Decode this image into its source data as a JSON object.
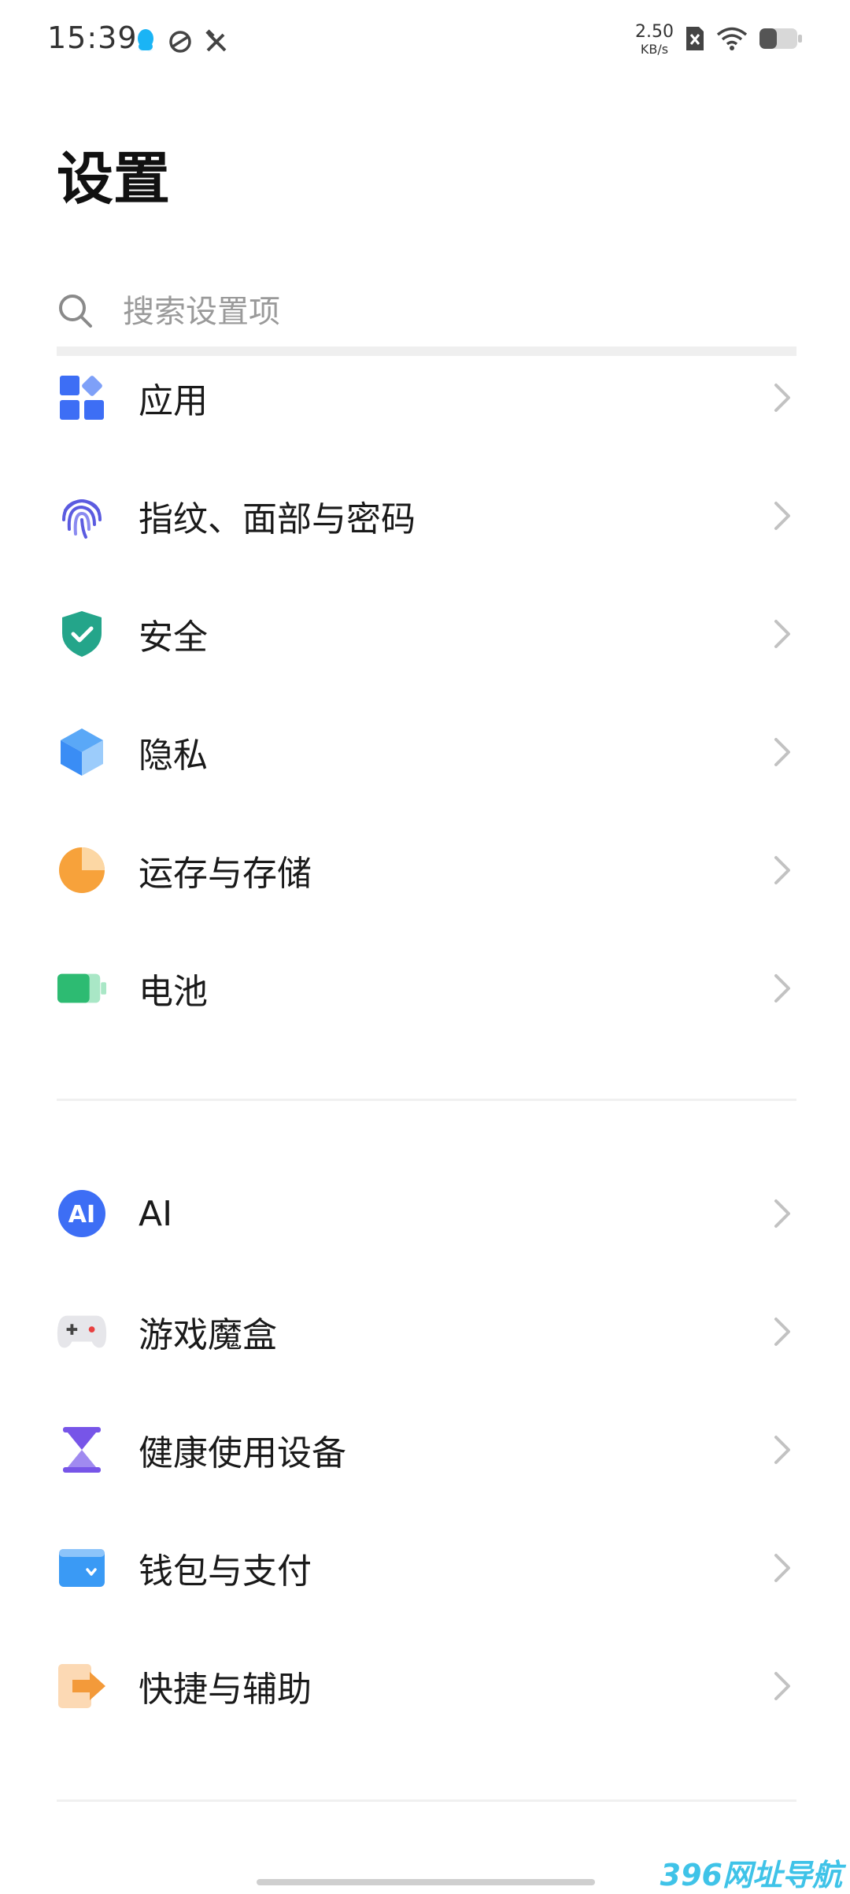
{
  "status_bar": {
    "time": "15:39",
    "net_speed_value": "2.50",
    "net_speed_unit": "KB/s",
    "icons": [
      "qq-icon",
      "sync-icon",
      "tools-icon",
      "no-sim-icon",
      "wifi-icon",
      "battery-icon"
    ]
  },
  "page": {
    "title": "设置"
  },
  "search": {
    "placeholder": "搜索设置项"
  },
  "groups": [
    {
      "items": [
        {
          "label": "应用",
          "icon": "apps-icon"
        },
        {
          "label": "指纹、面部与密码",
          "icon": "fingerprint-icon"
        },
        {
          "label": "安全",
          "icon": "shield-icon"
        },
        {
          "label": "隐私",
          "icon": "privacy-cube-icon"
        },
        {
          "label": "运存与存储",
          "icon": "storage-pie-icon"
        },
        {
          "label": "电池",
          "icon": "battery-icon"
        }
      ]
    },
    {
      "items": [
        {
          "label": "AI",
          "icon": "ai-icon"
        },
        {
          "label": "游戏魔盒",
          "icon": "gamepad-icon"
        },
        {
          "label": "健康使用设备",
          "icon": "hourglass-icon"
        },
        {
          "label": "钱包与支付",
          "icon": "wallet-icon"
        },
        {
          "label": "快捷与辅助",
          "icon": "shortcut-icon"
        }
      ]
    }
  ],
  "colors": {
    "apps": "#3d6ef5",
    "fingerprint": "#5b5be0",
    "security": "#24a58a",
    "privacy": "#3a8df5",
    "storage": "#f7a23b",
    "battery": "#2dbb72",
    "ai": "#3d6ef5",
    "hourglass": "#7755e8",
    "wallet": "#3a9af5",
    "shortcut": "#f39a3a"
  },
  "watermark": "396网址导航"
}
